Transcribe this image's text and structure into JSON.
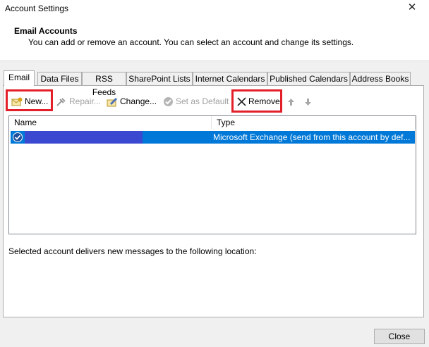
{
  "window": {
    "title": "Account Settings",
    "close_glyph": "✕"
  },
  "header": {
    "title": "Email Accounts",
    "description": "You can add or remove an account. You can select an account and change its settings."
  },
  "tabs": [
    {
      "label": "Email",
      "active": true
    },
    {
      "label": "Data Files"
    },
    {
      "label": "RSS Feeds"
    },
    {
      "label": "SharePoint Lists"
    },
    {
      "label": "Internet Calendars"
    },
    {
      "label": "Published Calendars"
    },
    {
      "label": "Address Books"
    }
  ],
  "toolbar": {
    "new_label": "New...",
    "repair_label": "Repair...",
    "change_label": "Change...",
    "set_default_label": "Set as Default",
    "remove_label": "Remove",
    "icons": [
      "new-account-icon",
      "repair-icon",
      "change-icon",
      "set-default-icon",
      "remove-icon",
      "arrow-up-icon",
      "arrow-down-icon"
    ]
  },
  "accounts_list": {
    "columns": [
      "Name",
      "Type"
    ],
    "rows": [
      {
        "type": "Microsoft Exchange (send from this account by def...",
        "selected": true
      }
    ]
  },
  "delivery_text": "Selected account delivers new messages to the following location:",
  "footer": {
    "close_label": "Close"
  },
  "colors": {
    "selection": "#0078d7",
    "highlight": "#e3202a",
    "redaction": "#3b49d0"
  }
}
